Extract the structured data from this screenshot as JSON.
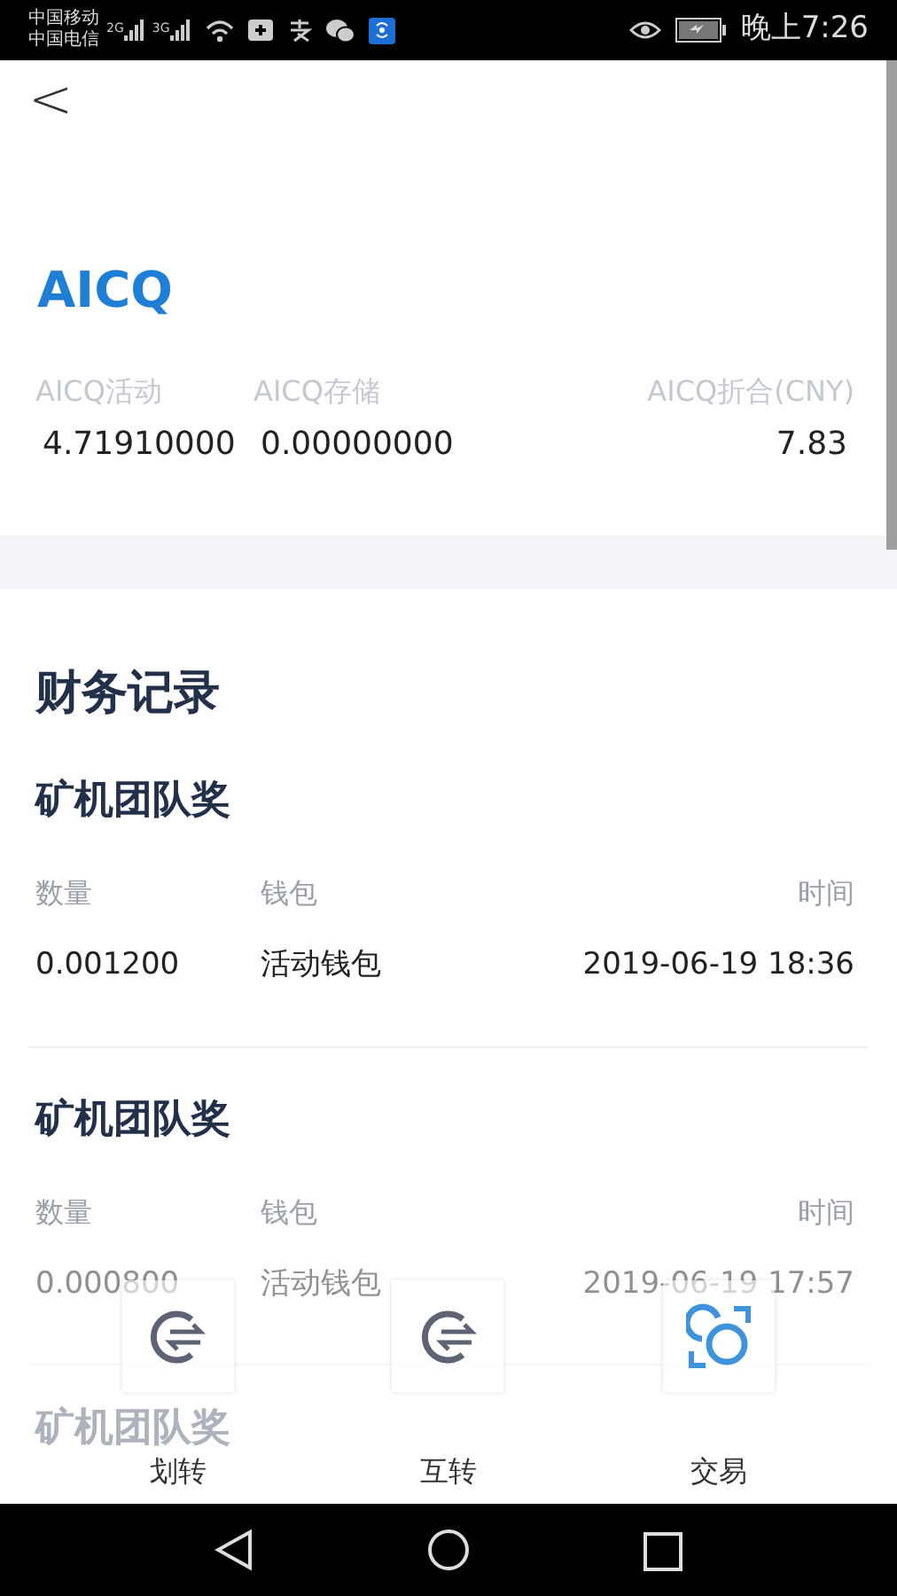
{
  "status_bar": {
    "carrier_1": "中国移动",
    "carrier_2": "中国电信",
    "network_1": "2G",
    "network_2": "3G",
    "time": "晚上7:26"
  },
  "header": {
    "back": "<",
    "title": "AICQ",
    "balances": [
      {
        "label": "AICQ活动",
        "value": "4.71910000"
      },
      {
        "label": "AICQ存储",
        "value": "0.00000000"
      },
      {
        "label": "AICQ折合(CNY)",
        "value": "7.83"
      }
    ]
  },
  "records": {
    "title": "财务记录",
    "items": [
      {
        "title": "矿机团队奖",
        "columns": [
          "数量",
          "钱包",
          "时间"
        ],
        "values": [
          "0.001200",
          "活动钱包",
          "2019-06-19 18:36"
        ]
      },
      {
        "title": "矿机团队奖",
        "columns": [
          "数量",
          "钱包",
          "时间"
        ],
        "values": [
          "0.000800",
          "活动钱包",
          "2019-06-19 17:57"
        ]
      },
      {
        "title": "矿机团队奖"
      }
    ]
  },
  "actions": [
    {
      "label": "划转",
      "kind": "transfer"
    },
    {
      "label": "互转",
      "kind": "transfer"
    },
    {
      "label": "交易",
      "kind": "exchange"
    }
  ]
}
